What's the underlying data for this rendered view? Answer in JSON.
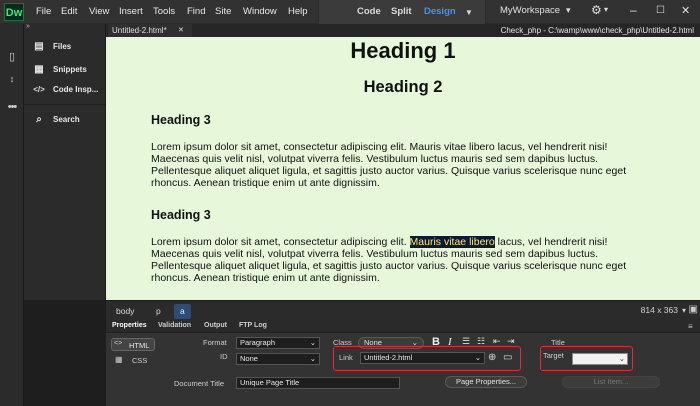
{
  "app": {
    "logo": "Dw"
  },
  "menu": [
    "File",
    "Edit",
    "View",
    "Insert",
    "Tools",
    "Find",
    "Site",
    "Window",
    "Help"
  ],
  "view_switch": {
    "code": "Code",
    "split": "Split",
    "design": "Design",
    "active": "Design",
    "active_color": "#4a8cff"
  },
  "workspace": {
    "label": "MyWorkspace",
    "caret": "▾"
  },
  "panel": {
    "items": [
      {
        "label": "Files",
        "icon": "files-icon"
      },
      {
        "label": "Snippets",
        "icon": "snippets-icon"
      },
      {
        "label": "Code Insp...",
        "icon": "code-inspector-icon"
      },
      {
        "label": "Search",
        "icon": "search-icon"
      }
    ]
  },
  "document": {
    "tab_label": "Untitled-2.html*",
    "path": "Check_php - C:\\wamp\\www\\check_php\\Untitled-2.html",
    "h1": "Heading 1",
    "h2": "Heading 2",
    "h3a": "Heading 3",
    "h3b": "Heading 3",
    "para1": "Lorem ipsum dolor sit amet, consectetur adipiscing elit. Mauris vitae libero lacus, vel hendrerit nisi! Maecenas quis velit nisl, volutpat viverra felis. Vestibulum luctus mauris sed sem dapibus luctus. Pellentesque aliquet aliquet ligula, et sagittis justo auctor varius. Quisque varius scelerisque nunc eget rhoncus. Aenean tristique enim ut ante dignissim.",
    "para2_before": "Lorem ipsum dolor sit amet, consectetur adipiscing elit. ",
    "para2_link": "Mauris vitae libero",
    "para2_after": " lacus, vel hendrerit nisi! Maecenas quis velit nisl, volutpat viverra felis. Vestibulum luctus mauris sed sem dapibus luctus. Pellentesque aliquet aliquet ligula, et sagittis justo auctor varius. Quisque varius scelerisque nunc eget rhoncus. Aenean tristique enim ut ante dignissim.",
    "background": "#e6f8d9"
  },
  "status": {
    "tags": [
      "body",
      "p",
      "a"
    ],
    "dimensions": "814 x 363"
  },
  "properties": {
    "tabs": [
      "Properties",
      "Validation",
      "Output",
      "FTP Log"
    ],
    "mode_html": "HTML",
    "mode_css": "CSS",
    "format_label": "Format",
    "format_value": "Paragraph",
    "id_label": "ID",
    "id_value": "None",
    "class_label": "Class",
    "class_value": "None",
    "bold": "B",
    "italic": "I",
    "title_label": "Title",
    "link_label": "Link",
    "link_value": "Untitled-2.html",
    "target_label": "Target",
    "target_value": "",
    "doc_title_label": "Document Title",
    "doc_title_value": "Unique Page Title",
    "page_props_button": "Page Properties...",
    "list_item_button": "List Item..."
  }
}
